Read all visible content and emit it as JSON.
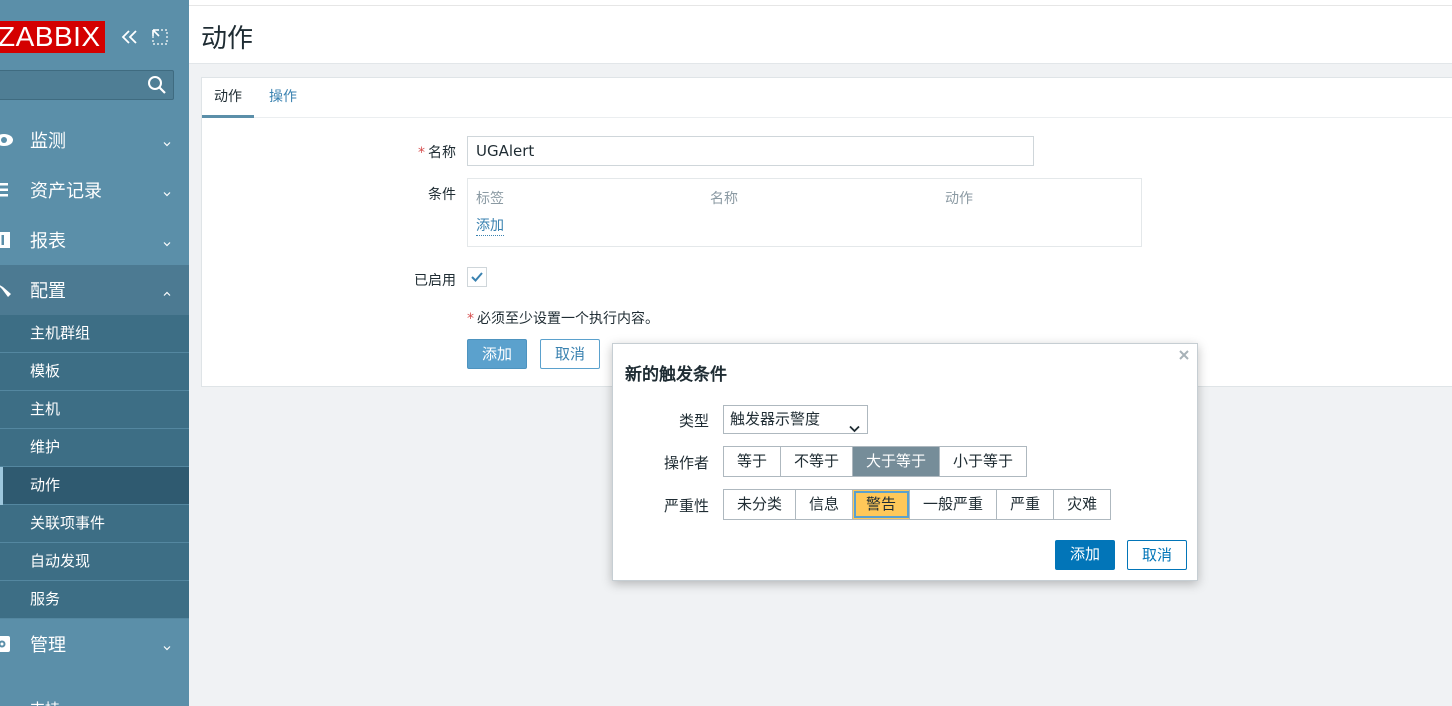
{
  "brand": {
    "logo_text": "ZABBIX",
    "logo_color": "#d40000"
  },
  "sidebar": {
    "search_placeholder": "",
    "menu": [
      {
        "label": "监测",
        "icon": "eye-icon"
      },
      {
        "label": "资产记录",
        "icon": "list-icon"
      },
      {
        "label": "报表",
        "icon": "bar-chart-icon"
      },
      {
        "label": "配置",
        "icon": "wrench-icon"
      }
    ],
    "config_submenu": [
      "主机群组",
      "模板",
      "主机",
      "维护",
      "动作",
      "关联项事件",
      "自动发现",
      "服务"
    ],
    "admin_label": "管理",
    "bottom_partial": "支持"
  },
  "page": {
    "title": "动作",
    "tabs": [
      "动作",
      "操作"
    ],
    "form": {
      "name_label": "名称",
      "name_value": "UGAlert",
      "conditions_label": "条件",
      "conditions_headers": [
        "标签",
        "名称",
        "动作"
      ],
      "conditions_add": "添加",
      "enabled_label": "已启用",
      "required_note": "必须至少设置一个执行内容。",
      "add_button": "添加",
      "cancel_button": "取消"
    }
  },
  "dialog": {
    "title": "新的触发条件",
    "type_label": "类型",
    "type_value": "触发器示警度",
    "operator_label": "操作者",
    "operators": [
      "等于",
      "不等于",
      "大于等于",
      "小于等于"
    ],
    "operator_selected": "大于等于",
    "severity_label": "严重性",
    "severities": [
      "未分类",
      "信息",
      "警告",
      "一般严重",
      "严重",
      "灾难"
    ],
    "severity_selected": "警告",
    "add_button": "添加",
    "cancel_button": "取消"
  },
  "colors": {
    "sidebar_bg": "#5b8fa9",
    "accent": "#5ba1cd",
    "primary_dialog": "#0275b8",
    "warning": "#ffc859",
    "operator_selected": "#768d99"
  }
}
